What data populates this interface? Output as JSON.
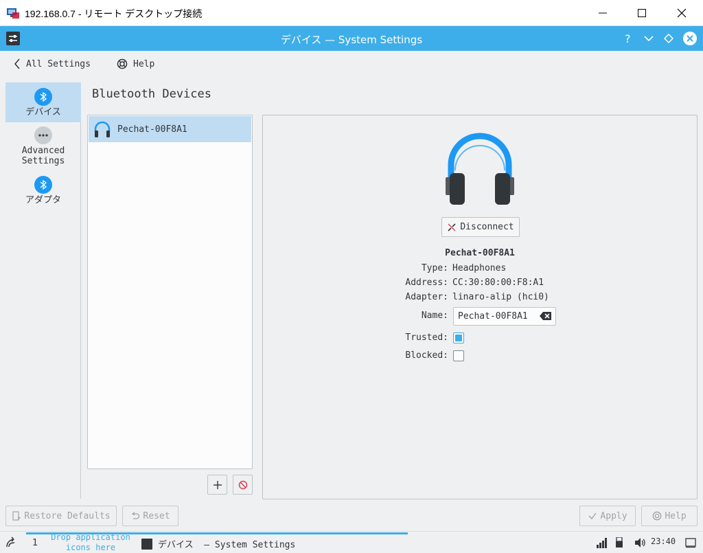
{
  "window": {
    "title": "192.168.0.7 - リモート デスクトップ接続"
  },
  "kde": {
    "title": "デバイス — System Settings"
  },
  "toolbar": {
    "back_label": "All Settings",
    "help_label": "Help"
  },
  "categories": [
    {
      "label": "デバイス",
      "icon": "bluetooth-icon",
      "selected": true
    },
    {
      "label": "Advanced Settings",
      "icon": "more-icon",
      "selected": false
    },
    {
      "label": "アダプタ",
      "icon": "bluetooth-icon",
      "selected": false
    }
  ],
  "page_heading": "Bluetooth Devices",
  "device_list": [
    {
      "name": "Pechat-00F8A1",
      "icon": "headphones-icon",
      "selected": true
    }
  ],
  "detail": {
    "disconnect_label": "Disconnect",
    "device_name": "Pechat-00F8A1",
    "type_label": "Type:",
    "type_value": "Headphones",
    "address_label": "Address:",
    "address_value": "CC:30:80:00:F8:A1",
    "adapter_label": "Adapter:",
    "adapter_value": "linaro-alip (hci0)",
    "name_label": "Name:",
    "name_value": "Pechat-00F8A1",
    "trusted_label": "Trusted:",
    "trusted": true,
    "blocked_label": "Blocked:",
    "blocked": false
  },
  "bottom_buttons": {
    "restore_defaults": "Restore Defaults",
    "reset": "Reset",
    "apply": "Apply",
    "help": "Help"
  },
  "taskbar": {
    "desktop_number": "1",
    "drop_hint_line1": "Drop application",
    "drop_hint_line2": "icons here",
    "task_label": "デバイス  — System Settings",
    "clock": "23:40"
  },
  "colors": {
    "accent": "#3daee9",
    "selection": "#c0dcf2",
    "window_bg": "#eff0f1"
  }
}
